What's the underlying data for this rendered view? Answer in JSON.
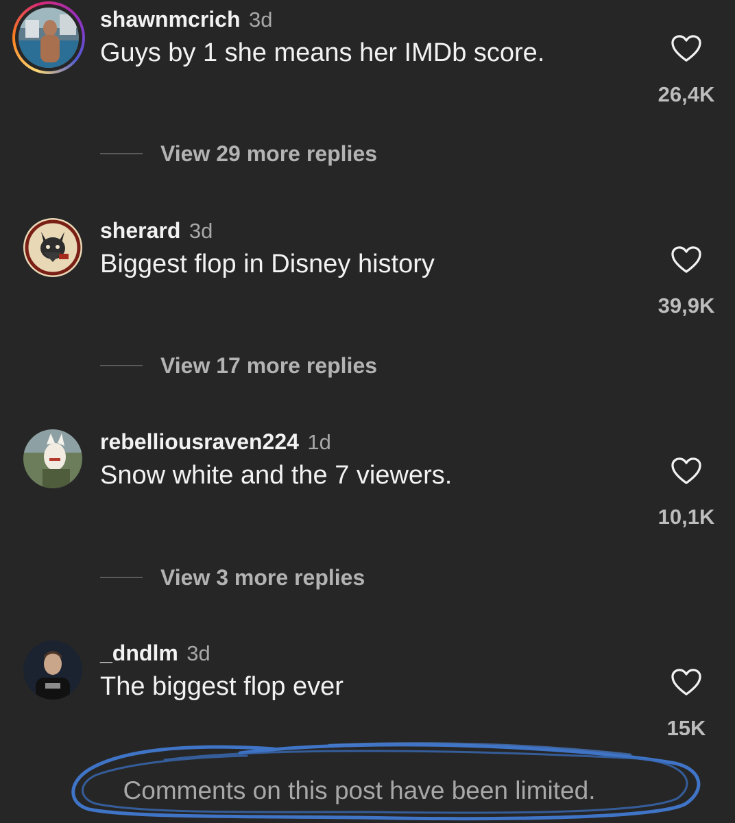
{
  "comments": [
    {
      "username": "shawnmcrich",
      "time": "3d",
      "text": "Guys by 1 she means her IMDb score.",
      "likes": "26,4K",
      "replies": "View 29 more replies",
      "avatar": "pool-photo"
    },
    {
      "username": "sherard",
      "time": "3d",
      "text": "Biggest flop in Disney history",
      "likes": "39,9K",
      "replies": "View 17 more replies",
      "avatar": "wolf-emblem"
    },
    {
      "username": "rebelliousraven224",
      "time": "1d",
      "text": "Snow white and the 7 viewers.",
      "likes": "10,1K",
      "replies": "View 3 more replies",
      "avatar": "anime-character"
    },
    {
      "username": "_dndlm",
      "time": "3d",
      "text": "The biggest flop ever",
      "likes": "15K",
      "avatar": "portrait-photo"
    }
  ],
  "footer": {
    "limited_text": "Comments on this post have been limited."
  },
  "colors": {
    "background": "#262626",
    "scribble": "#3f74c7"
  },
  "icons": {
    "like": "heart-outline-icon"
  }
}
